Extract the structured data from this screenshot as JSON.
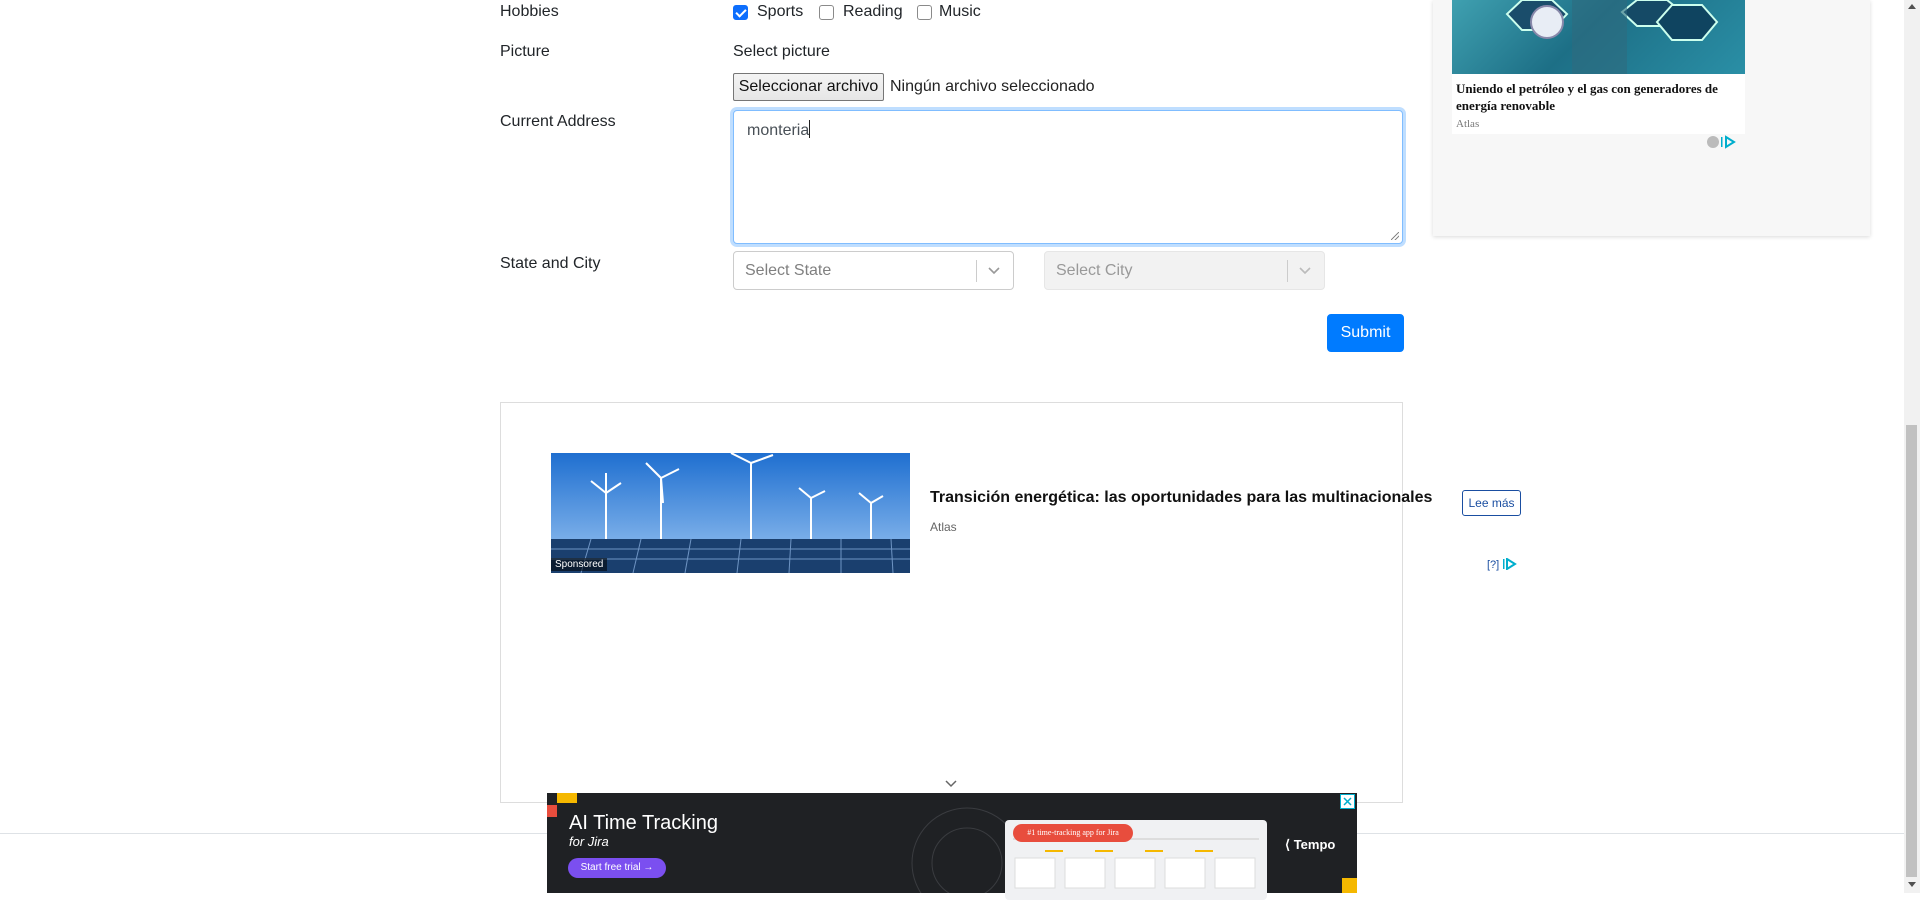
{
  "form": {
    "hobbies": {
      "label": "Hobbies",
      "options": [
        {
          "label": "Sports",
          "checked": true
        },
        {
          "label": "Reading",
          "checked": false
        },
        {
          "label": "Music",
          "checked": false
        }
      ]
    },
    "picture": {
      "label": "Picture",
      "caption": "Select picture",
      "button": "Seleccionar archivo",
      "status": "Ningún archivo seleccionado"
    },
    "address": {
      "label": "Current Address",
      "value": "monteria"
    },
    "state_city": {
      "label": "State and City",
      "state_placeholder": "Select State",
      "city_placeholder": "Select City"
    },
    "submit_label": "Submit"
  },
  "side_ad": {
    "title": "Uniendo el petróleo y el gas con generadores de energía renovable",
    "source": "Atlas"
  },
  "main_ad": {
    "badge": "Sponsored",
    "title": "Transición energética: las oportunidades para las multinacionales",
    "source": "Atlas",
    "button": "Lee más",
    "marker": "[?]"
  },
  "banner_ad": {
    "title": "AI Time Tracking",
    "subtitle": "for Jira",
    "cta": "Start free trial",
    "pill": "#1 time-tracking app for Jira",
    "brand": "Tempo"
  },
  "colors": {
    "primary": "#007bff",
    "focus_border": "#80bdff",
    "banner_bg": "#1f2124",
    "banner_cta": "#7b4ff0"
  }
}
